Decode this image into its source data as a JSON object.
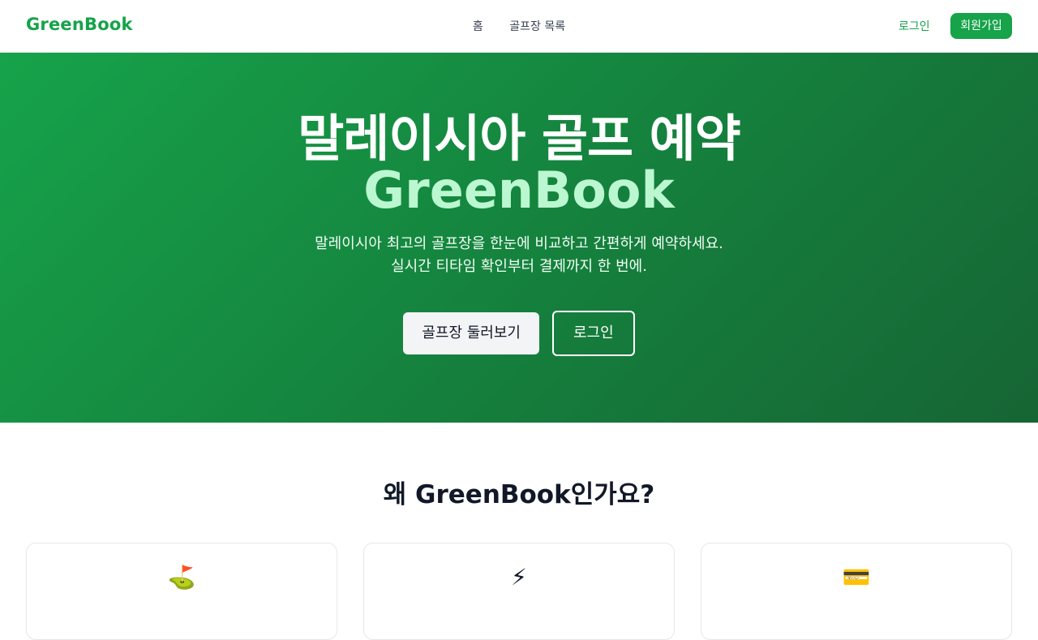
{
  "header": {
    "brand": "GreenBook",
    "nav": [
      {
        "label": "홈"
      },
      {
        "label": "골프장 목록"
      }
    ],
    "login_label": "로그인",
    "signup_label": "회원가입"
  },
  "hero": {
    "title": "말레이시아 골프 예약",
    "title_accent": "GreenBook",
    "subtitle_line1": "말레이시아 최고의 골프장을 한눈에 비교하고 간편하게 예약하세요.",
    "subtitle_line2": "실시간 티타임 확인부터 결제까지 한 번에.",
    "primary_button": "골프장 둘러보기",
    "secondary_button": "로그인"
  },
  "why": {
    "title": "왜 GreenBook인가요?",
    "cards": [
      {
        "icon": "⛳",
        "icon_name": "golf-flag-icon"
      },
      {
        "icon": "⚡",
        "icon_name": "lightning-icon"
      },
      {
        "icon": "💳",
        "icon_name": "card-icon"
      }
    ]
  },
  "colors": {
    "brand": "#16a34a",
    "hero_gradient_start": "#16a34a",
    "hero_gradient_end": "#166534",
    "accent_text": "#bbf7d0"
  }
}
